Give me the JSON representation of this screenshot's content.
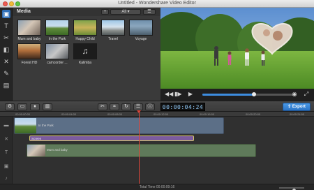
{
  "window": {
    "title": "Untitled - Wondershare Video Editor"
  },
  "media": {
    "header": "Media",
    "filter": "All",
    "items": [
      {
        "label": "Mum and baby",
        "icon": "photo-thumb"
      },
      {
        "label": "In the Park",
        "icon": "photo-thumb"
      },
      {
        "label": "Happy Child",
        "icon": "photo-thumb"
      },
      {
        "label": "Travel",
        "icon": "photo-thumb"
      },
      {
        "label": "Voyage",
        "icon": "photo-thumb"
      },
      {
        "label": "Forest HD",
        "icon": "photo-thumb"
      },
      {
        "label": "camcorder ...",
        "icon": "photo-thumb"
      },
      {
        "label": "Kalimba",
        "icon": "music-note-icon"
      }
    ]
  },
  "preview": {
    "progress": 0.55
  },
  "toolbar": {
    "timecode": "00:00:04:24",
    "export_label": "Export"
  },
  "timeline": {
    "ruler": [
      "00:00:00:00",
      "00:00:04:00",
      "00:00:08:00",
      "00:00:12:00",
      "00:00:16:00",
      "00:00:20:00",
      "00:00:24:00"
    ],
    "clips": {
      "video": "In the Park",
      "text": "Screen",
      "pip": "Mum and baby"
    }
  },
  "status": {
    "total_time": "Total Time 00:00:09:16",
    "zoom": 0.6
  }
}
